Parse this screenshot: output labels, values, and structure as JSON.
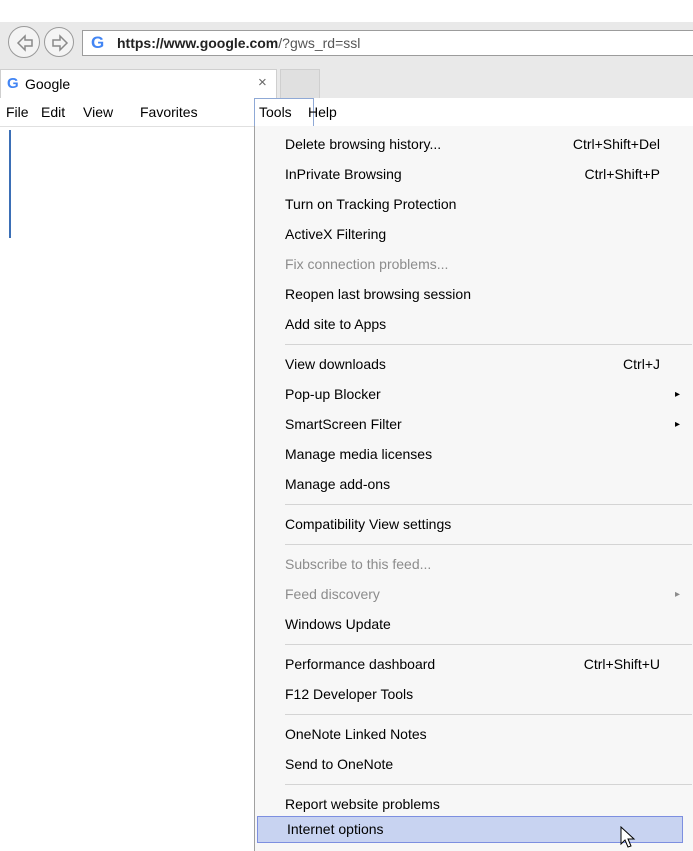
{
  "address_bar": {
    "favicon": "G",
    "url_proto": "https://",
    "url_host": "www.google.com",
    "url_path": "/?gws_rd=ssl"
  },
  "tab": {
    "favicon": "G",
    "title": "Google",
    "close_glyph": "×"
  },
  "menubar": {
    "file": "File",
    "edit": "Edit",
    "view": "View",
    "favorites": "Favorites",
    "tools": "Tools",
    "help": "Help"
  },
  "tools_menu": {
    "items": [
      {
        "label": "Delete browsing history...",
        "shortcut": "Ctrl+Shift+Del"
      },
      {
        "label": "InPrivate Browsing",
        "shortcut": "Ctrl+Shift+P"
      },
      {
        "label": "Turn on Tracking Protection"
      },
      {
        "label": "ActiveX Filtering"
      },
      {
        "label": "Fix connection problems...",
        "disabled": true
      },
      {
        "label": "Reopen last browsing session"
      },
      {
        "label": "Add site to Apps"
      },
      {
        "label": "View downloads",
        "shortcut": "Ctrl+J"
      },
      {
        "label": "Pop-up Blocker",
        "submenu": "▸"
      },
      {
        "label": "SmartScreen Filter",
        "submenu": "▸"
      },
      {
        "label": "Manage media licenses"
      },
      {
        "label": "Manage add-ons"
      },
      {
        "label": "Compatibility View settings"
      },
      {
        "label": "Subscribe to this feed...",
        "disabled": true
      },
      {
        "label": "Feed discovery",
        "disabled": true,
        "submenu": "▸"
      },
      {
        "label": "Windows Update"
      },
      {
        "label": "Performance dashboard",
        "shortcut": "Ctrl+Shift+U"
      },
      {
        "label": "F12 Developer Tools"
      },
      {
        "label": "OneNote Linked Notes"
      },
      {
        "label": "Send to OneNote"
      },
      {
        "label": "Report website problems"
      },
      {
        "label": "Internet options",
        "highlighted": true
      }
    ]
  },
  "colors": {
    "highlight": "#c8d3f1",
    "highlight_border": "#7d8fe0",
    "disabled_text": "#8c8c8c",
    "google_blue": "#4285f4"
  }
}
